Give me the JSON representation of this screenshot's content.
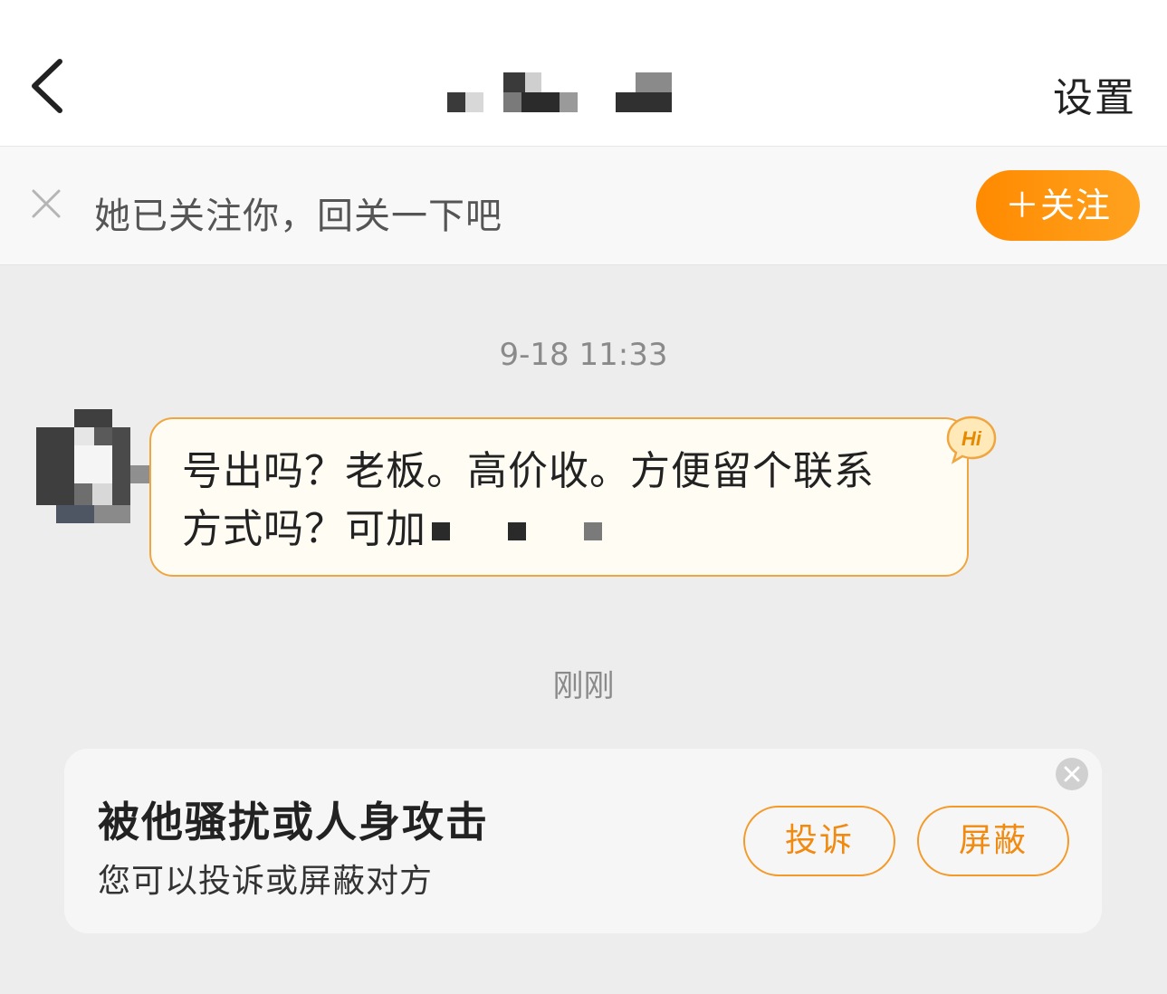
{
  "header": {
    "back_icon": "chevron-left-icon",
    "settings_label": "设置"
  },
  "follow_bar": {
    "close_icon": "close-icon",
    "text": "她已关注你，回关一下吧",
    "follow_button": "＋关注"
  },
  "chat": {
    "messages": [
      {
        "timestamp": "9-18 11:33",
        "text_line1": "号出吗？老板。高价收。方便留个联系",
        "text_line2": "方式吗？可加",
        "badge_icon": "hi-badge-icon",
        "badge_text": "Hi"
      }
    ],
    "second_timestamp": "刚刚"
  },
  "report_card": {
    "title": "被他骚扰或人身攻击",
    "subtitle": "您可以投诉或屏蔽对方",
    "complain_button": "投诉",
    "block_button": "屏蔽",
    "close_icon": "close-circle-icon"
  },
  "colors": {
    "accent": "#ff8a00",
    "bubble_border": "#f0a640",
    "bubble_bg": "#fffcf3"
  }
}
